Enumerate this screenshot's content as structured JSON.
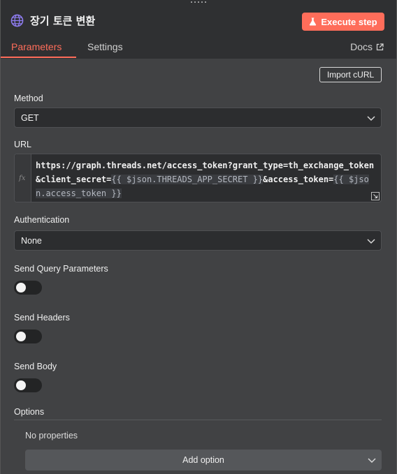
{
  "header": {
    "title": "장기 토큰 변환",
    "title_icon": "globe-icon",
    "execute_label": "Execute step",
    "execute_icon": "flask-icon",
    "accent_color": "#ff6d5a"
  },
  "tabs": [
    {
      "label": "Parameters",
      "active": true
    },
    {
      "label": "Settings",
      "active": false
    }
  ],
  "docs_label": "Docs",
  "import_curl_label": "Import cURL",
  "method": {
    "label": "Method",
    "value": "GET"
  },
  "url": {
    "label": "URL",
    "fx": "fx",
    "part1": "https://graph.threads.net/access_token?grant_type=th_exchange_token&client_secret=",
    "expr1": "{{ $json.THREADS_APP_SECRET }}",
    "part2": "&access_token=",
    "expr2": "{{ $json.access_token }}"
  },
  "authentication": {
    "label": "Authentication",
    "value": "None"
  },
  "send_query": {
    "label": "Send Query Parameters",
    "enabled": false
  },
  "send_headers": {
    "label": "Send Headers",
    "enabled": false
  },
  "send_body": {
    "label": "Send Body",
    "enabled": false
  },
  "options": {
    "label": "Options",
    "empty_text": "No properties",
    "add_label": "Add option"
  }
}
